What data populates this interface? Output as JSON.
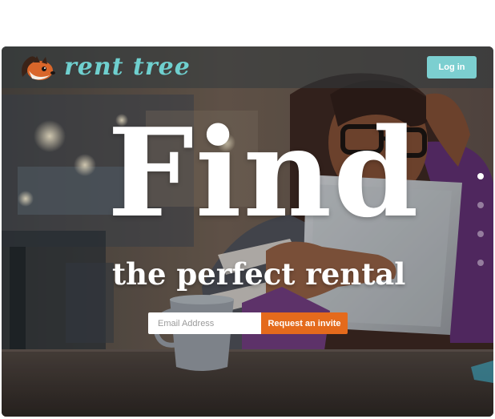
{
  "brand": {
    "name": "rent tree",
    "accent_color": "#6fd0cf"
  },
  "header": {
    "login_label": "Log in",
    "login_color": "#7ccfd0"
  },
  "hero": {
    "headline": "Find",
    "subheadline": "the perfect rental"
  },
  "signup": {
    "email_placeholder": "Email Address",
    "submit_label": "Request an invite",
    "submit_color": "#e46a1c"
  },
  "carousel": {
    "slide_count": 4,
    "active_index": 0
  },
  "icons": {
    "logo": "squirrel-mascot-icon"
  }
}
